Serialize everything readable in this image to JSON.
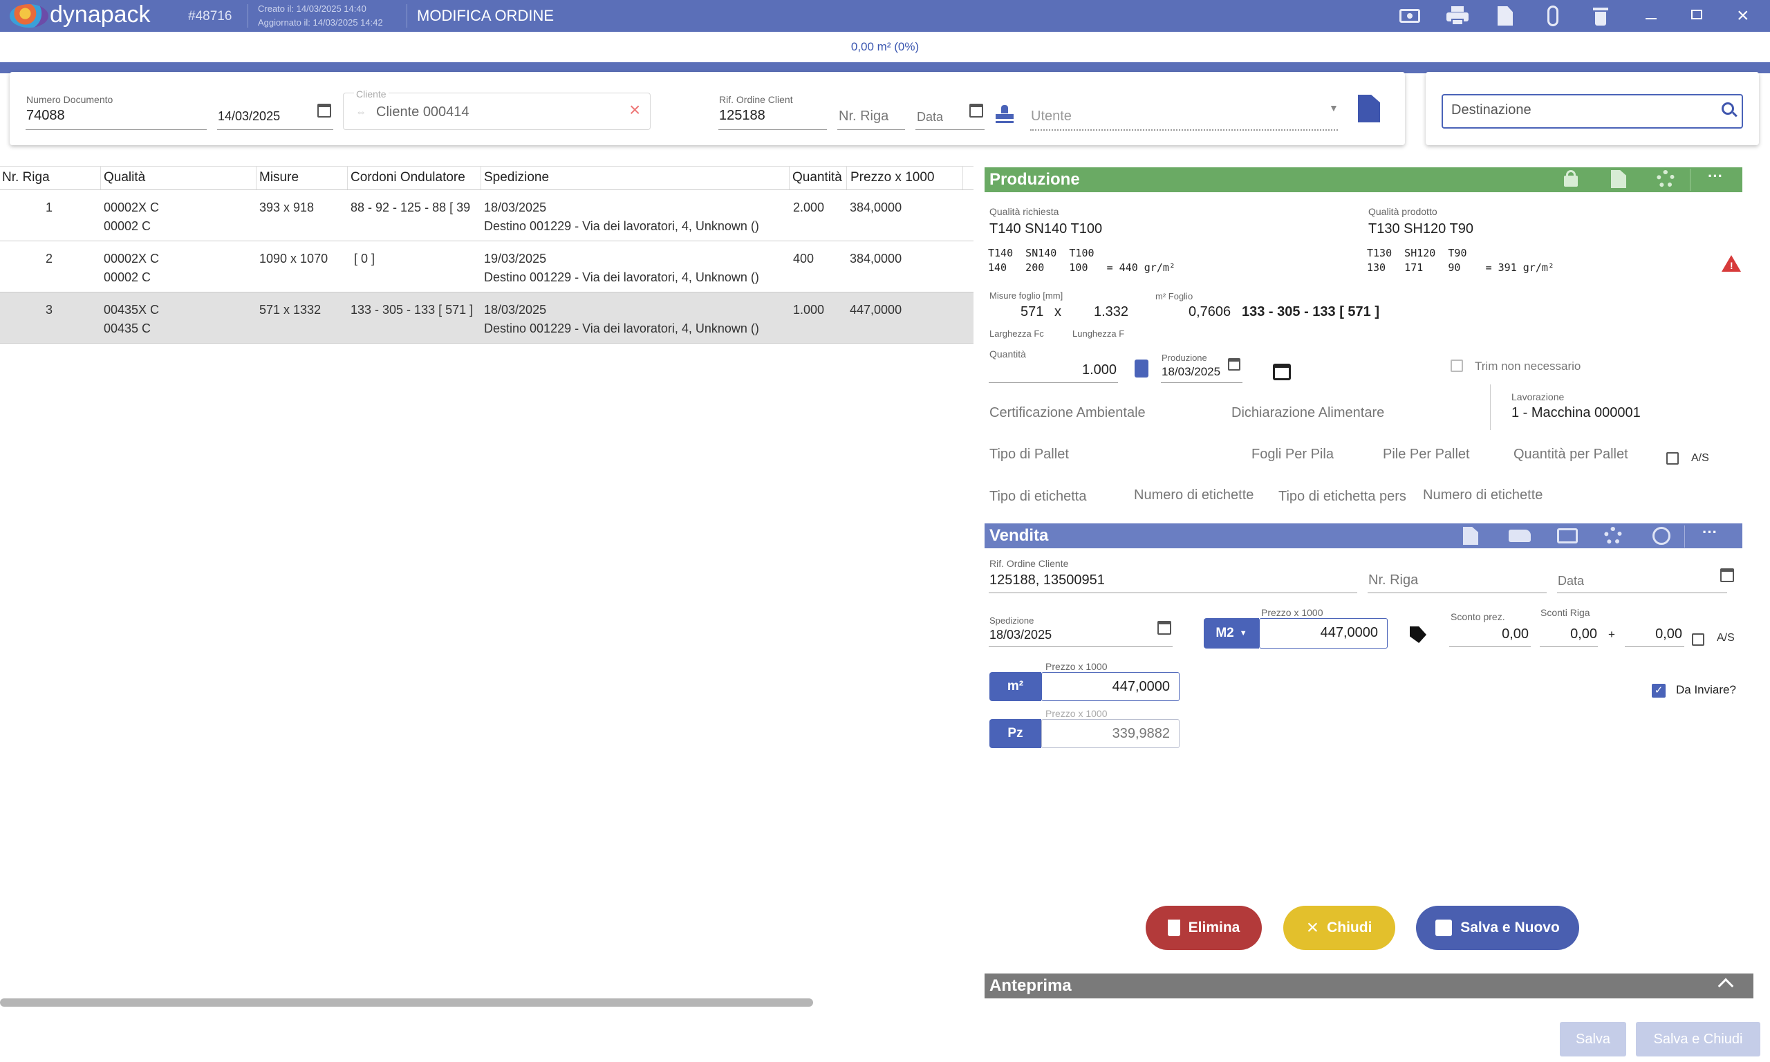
{
  "app": {
    "logo": "dynapack",
    "order_id": "#48716",
    "created": "Creato il: 14/03/2025 14:40",
    "updated": "Aggiornato il: 14/03/2025 14:42",
    "title": "MODIFICA ORDINE",
    "area_summary": "0,00 m² (0%)"
  },
  "header": {
    "numero_documento_label": "Numero Documento",
    "numero_documento": "74088",
    "date": "14/03/2025",
    "cliente_label": "Cliente",
    "cliente": "Cliente 000414",
    "rif_label": "Rif. Ordine Client",
    "rif": "125188",
    "nr_riga_placeholder": "Nr. Riga",
    "data_placeholder": "Data",
    "utente_placeholder": "Utente",
    "destinazione_placeholder": "Destinazione"
  },
  "table": {
    "columns": [
      "Nr. Riga",
      "Qualità",
      "Misure",
      "Cordoni Ondulatore",
      "Spedizione",
      "Quantità",
      "Prezzo x 1000"
    ],
    "rows": [
      {
        "n": "1",
        "q1": "00002X C",
        "q2": "00002 C",
        "misure": "393 x 918",
        "cordoni": "88 - 92 - 125 - 88 [ 39",
        "sped": "18/03/2025",
        "dest": "Destino 001229 - Via dei lavoratori, 4, Unknown ()",
        "qty": "2.000",
        "price": "384,0000"
      },
      {
        "n": "2",
        "q1": "00002X C",
        "q2": "00002 C",
        "misure": "1090 x 1070",
        "cordoni": "[ 0 ]",
        "sped": "19/03/2025",
        "dest": "Destino 001229 - Via dei lavoratori, 4, Unknown ()",
        "qty": "400",
        "price": "384,0000"
      },
      {
        "n": "3",
        "q1": "00435X C",
        "q2": "00435 C",
        "misure": "571 x 1332",
        "cordoni": "133 - 305 - 133 [ 571 ]",
        "sped": "18/03/2025",
        "dest": "Destino 001229 - Via dei lavoratori, 4, Unknown ()",
        "qty": "1.000",
        "price": "447,0000"
      }
    ]
  },
  "produzione": {
    "title": "Produzione",
    "qualita_richiesta_label": "Qualità richiesta",
    "qualita_richiesta": "T140 SN140 T100",
    "qr_codes": "T140  SN140  T100",
    "qr_vals": "140   200    100   = 440 gr/m²",
    "qualita_prodotto_label": "Qualità prodotto",
    "qualita_prodotto": "T130 SH120 T90",
    "qp_codes": "T130  SH120  T90",
    "qp_vals": "130   171    90    = 391 gr/m²",
    "misure_label": "Misure foglio [mm]",
    "larghezza": "571",
    "x": "x",
    "lunghezza": "1.332",
    "larghezza_label": "Larghezza Fc",
    "lunghezza_label": "Lunghezza F",
    "m2_label": "m² Foglio",
    "m2": "0,7606",
    "cordoni": "133 - 305 - 133 [ 571 ]",
    "quantita_label": "Quantità",
    "quantita": "1.000",
    "produzione_label": "Produzione",
    "produzione_date": "18/03/2025",
    "trim": "Trim non necessario",
    "cert": "Certificazione Ambientale",
    "dich": "Dichiarazione Alimentare",
    "lav_label": "Lavorazione",
    "lav": "1 - Macchina 000001",
    "tipo_pallet": "Tipo di Pallet",
    "fogli_pila": "Fogli Per Pila",
    "pile_pallet": "Pile Per Pallet",
    "qty_pallet": "Quantità per Pallet",
    "as": "A/S",
    "tipo_etichetta": "Tipo di etichetta",
    "num_etichette": "Numero di etichette",
    "tipo_etichetta_pers": "Tipo di etichetta pers",
    "num_etichette2": "Numero di etichette"
  },
  "vendita": {
    "title": "Vendita",
    "rif_label": "Rif. Ordine Cliente",
    "rif": "125188, 13500951",
    "nr_riga": "Nr. Riga",
    "data": "Data",
    "sped_label": "Spedizione",
    "sped": "18/03/2025",
    "unit": "M2",
    "prezzo_label": "Prezzo x 1000",
    "prezzo": "447,0000",
    "sconto_label": "Sconto prez.",
    "sconto": "0,00",
    "sconti_label": "Sconti Riga",
    "sconti1": "0,00",
    "plus": "+",
    "sconti2": "0,00",
    "as": "A/S",
    "m2_btn": "m²",
    "m2_prezzo": "447,0000",
    "pz_btn": "Pz",
    "pz_prezzo": "339,9882",
    "da_inviare": "Da Inviare?"
  },
  "actions": {
    "elimina": "Elimina",
    "chiudi": "Chiudi",
    "salva_nuovo": "Salva e Nuovo",
    "salva": "Salva",
    "salva_chiudi": "Salva e Chiudi"
  },
  "anteprima": {
    "title": "Anteprima"
  },
  "colors": {
    "primary": "#5b6fb8",
    "produzione": "#6aaa64",
    "elimina": "#b33a3a",
    "chiudi": "#e3c02c",
    "anteprima": "#7a7a7a"
  }
}
